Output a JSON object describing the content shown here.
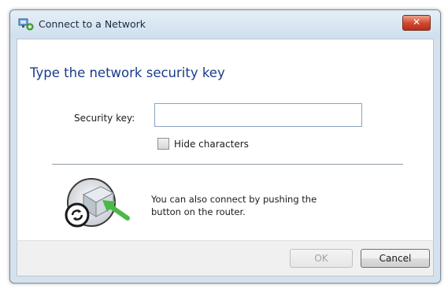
{
  "window": {
    "title": "Connect to a Network",
    "close_glyph": "✕"
  },
  "content": {
    "heading": "Type the network security key",
    "security_key_label": "Security key:",
    "security_key_value": "",
    "hide_characters_label": "Hide characters",
    "hide_characters_checked": false,
    "wps_message_line1": "You can also connect by pushing the",
    "wps_message_line2": "button on the router.",
    "wps_icon": "router-push-button-icon"
  },
  "footer": {
    "ok_label": "OK",
    "ok_enabled": false,
    "cancel_label": "Cancel"
  },
  "colors": {
    "heading": "#1a3c8c",
    "close_button": "#d1452c",
    "arrow": "#4cb848"
  }
}
